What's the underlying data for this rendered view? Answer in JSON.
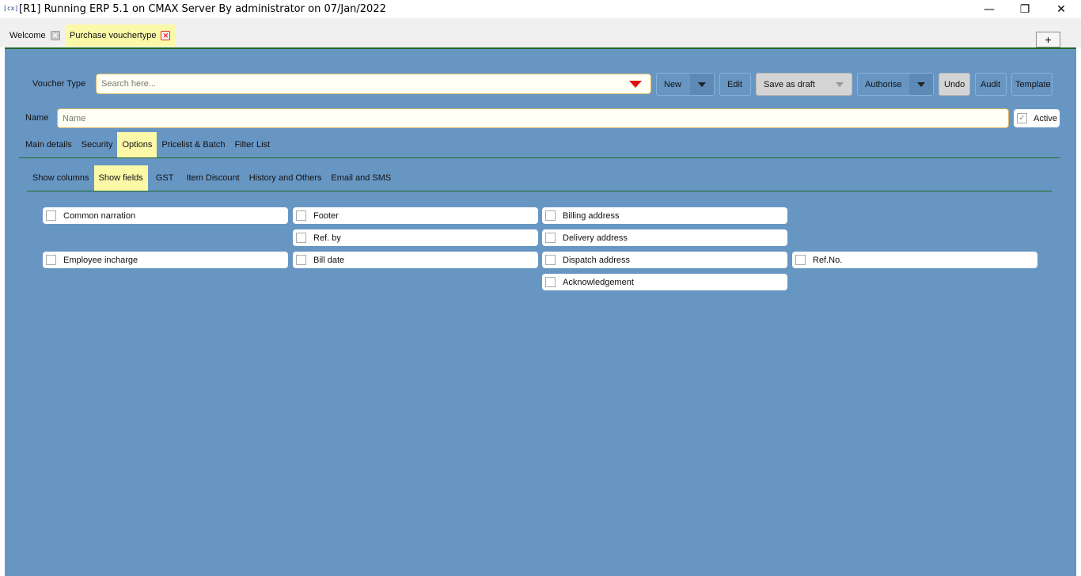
{
  "window": {
    "icon_text": "[cx]",
    "title": "[R1] Running ERP 5.1 on CMAX Server By administrator on 07/Jan/2022",
    "min_glyph": "—",
    "max_glyph": "❐",
    "close_glyph": "✕"
  },
  "doc_tabs": [
    {
      "label": "Welcome",
      "close": "✕"
    },
    {
      "label": "Purchase vouchertype",
      "close": "✕"
    }
  ],
  "add_tab_label": "+",
  "form": {
    "voucher_type_label": "Voucher Type",
    "search_placeholder": "Search here...",
    "name_label": "Name",
    "name_placeholder": "Name",
    "active_label": "Active",
    "active_checked": true
  },
  "toolbar": {
    "new": "New",
    "edit": "Edit",
    "save_as_draft": "Save as draft",
    "authorise": "Authorise",
    "undo": "Undo",
    "audit": "Audit",
    "template": "Template"
  },
  "main_tabs": [
    "Main details",
    "Security",
    "Options",
    "Pricelist & Batch",
    "Filter List"
  ],
  "main_tabs_selected": "Options",
  "sub_tabs": [
    "Show columns",
    "Show fields",
    "GST",
    "Item Discount",
    "History and Others",
    "Email and SMS"
  ],
  "sub_tabs_selected": "Show fields",
  "fields": {
    "common_narration": "Common narration",
    "employee_incharge": "Employee incharge",
    "footer": "Footer",
    "ref_by": "Ref. by",
    "bill_date": "Bill date",
    "billing_address": "Billing address",
    "delivery_address": "Delivery address",
    "dispatch_address": "Dispatch address",
    "acknowledgement": "Acknowledgement",
    "ref_no": "Ref.No."
  },
  "colors": {
    "panel_bg": "#6896c3",
    "selected_tab_bg": "#fbf9a8",
    "divider": "#1f6a28",
    "dropdown_arrow": "#e01010"
  }
}
